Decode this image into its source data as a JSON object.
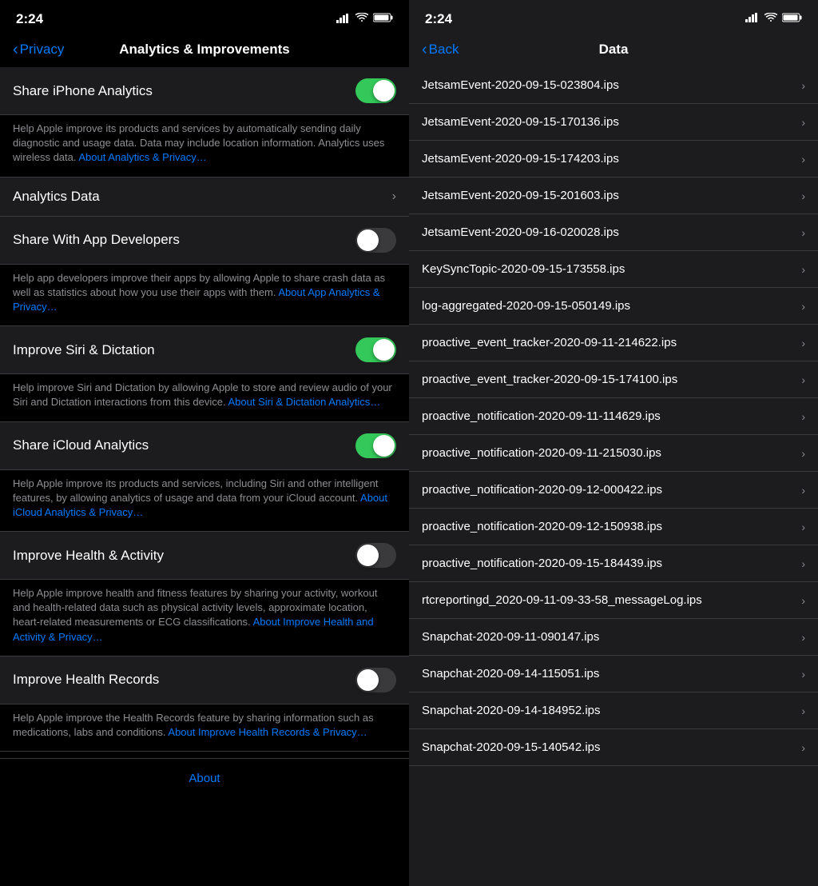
{
  "left": {
    "statusBar": {
      "time": "2:24",
      "signal": "▌▌▌",
      "wifi": "WiFi",
      "battery": "🔋"
    },
    "nav": {
      "backLabel": "Privacy",
      "title": "Analytics & Improvements"
    },
    "settings": [
      {
        "id": "share-iphone-analytics",
        "label": "Share iPhone Analytics",
        "type": "toggle",
        "value": true,
        "description": "Help Apple improve its products and services by automatically sending daily diagnostic and usage data. Data may include location information. Analytics uses wireless data.",
        "linkText": "About Analytics & Privacy…"
      },
      {
        "id": "analytics-data",
        "label": "Analytics Data",
        "type": "chevron",
        "value": null,
        "description": null
      },
      {
        "id": "share-with-app-developers",
        "label": "Share With App Developers",
        "type": "toggle",
        "value": false,
        "description": "Help app developers improve their apps by allowing Apple to share crash data as well as statistics about how you use their apps with them.",
        "linkText": "About App Analytics & Privacy…"
      },
      {
        "id": "improve-siri-dictation",
        "label": "Improve Siri & Dictation",
        "type": "toggle",
        "value": true,
        "description": "Help improve Siri and Dictation by allowing Apple to store and review audio of your Siri and Dictation interactions from this device.",
        "linkText": "About Siri & Dictation Analytics…"
      },
      {
        "id": "share-icloud-analytics",
        "label": "Share iCloud Analytics",
        "type": "toggle",
        "value": true,
        "description": "Help Apple improve its products and services, including Siri and other intelligent features, by allowing analytics of usage and data from your iCloud account.",
        "linkText": "About iCloud Analytics & Privacy…"
      },
      {
        "id": "improve-health-activity",
        "label": "Improve Health & Activity",
        "type": "toggle",
        "value": false,
        "description": "Help Apple improve health and fitness features by sharing your activity, workout and health-related data such as physical activity levels, approximate location, heart-related measurements or ECG classifications.",
        "linkText": "About Improve Health and Activity & Privacy…"
      },
      {
        "id": "improve-health-records",
        "label": "Improve Health Records",
        "type": "toggle",
        "value": false,
        "description": "Help Apple improve the Health Records feature by sharing information such as medications, labs and conditions.",
        "linkText": "About Improve Health Records & Privacy…"
      }
    ],
    "about": {
      "label": "About"
    }
  },
  "right": {
    "statusBar": {
      "time": "2:24",
      "signal": "▌▌▌",
      "wifi": "WiFi",
      "battery": "🔋"
    },
    "nav": {
      "backLabel": "Back",
      "title": "Data"
    },
    "items": [
      {
        "label": "JetsamEvent-2020-09-15-023804.ips"
      },
      {
        "label": "JetsamEvent-2020-09-15-170136.ips"
      },
      {
        "label": "JetsamEvent-2020-09-15-174203.ips"
      },
      {
        "label": "JetsamEvent-2020-09-15-201603.ips"
      },
      {
        "label": "JetsamEvent-2020-09-16-020028.ips"
      },
      {
        "label": "KeySyncTopic-2020-09-15-173558.ips"
      },
      {
        "label": "log-aggregated-2020-09-15-050149.ips"
      },
      {
        "label": "proactive_event_tracker-2020-09-11-214622.ips"
      },
      {
        "label": "proactive_event_tracker-2020-09-15-174100.ips"
      },
      {
        "label": "proactive_notification-2020-09-11-114629.ips"
      },
      {
        "label": "proactive_notification-2020-09-11-215030.ips"
      },
      {
        "label": "proactive_notification-2020-09-12-000422.ips"
      },
      {
        "label": "proactive_notification-2020-09-12-150938.ips"
      },
      {
        "label": "proactive_notification-2020-09-15-184439.ips"
      },
      {
        "label": "rtcreportingd_2020-09-11-09-33-58_messageLog.ips"
      },
      {
        "label": "Snapchat-2020-09-11-090147.ips"
      },
      {
        "label": "Snapchat-2020-09-14-115051.ips"
      },
      {
        "label": "Snapchat-2020-09-14-184952.ips"
      },
      {
        "label": "Snapchat-2020-09-15-140542.ips"
      }
    ]
  }
}
